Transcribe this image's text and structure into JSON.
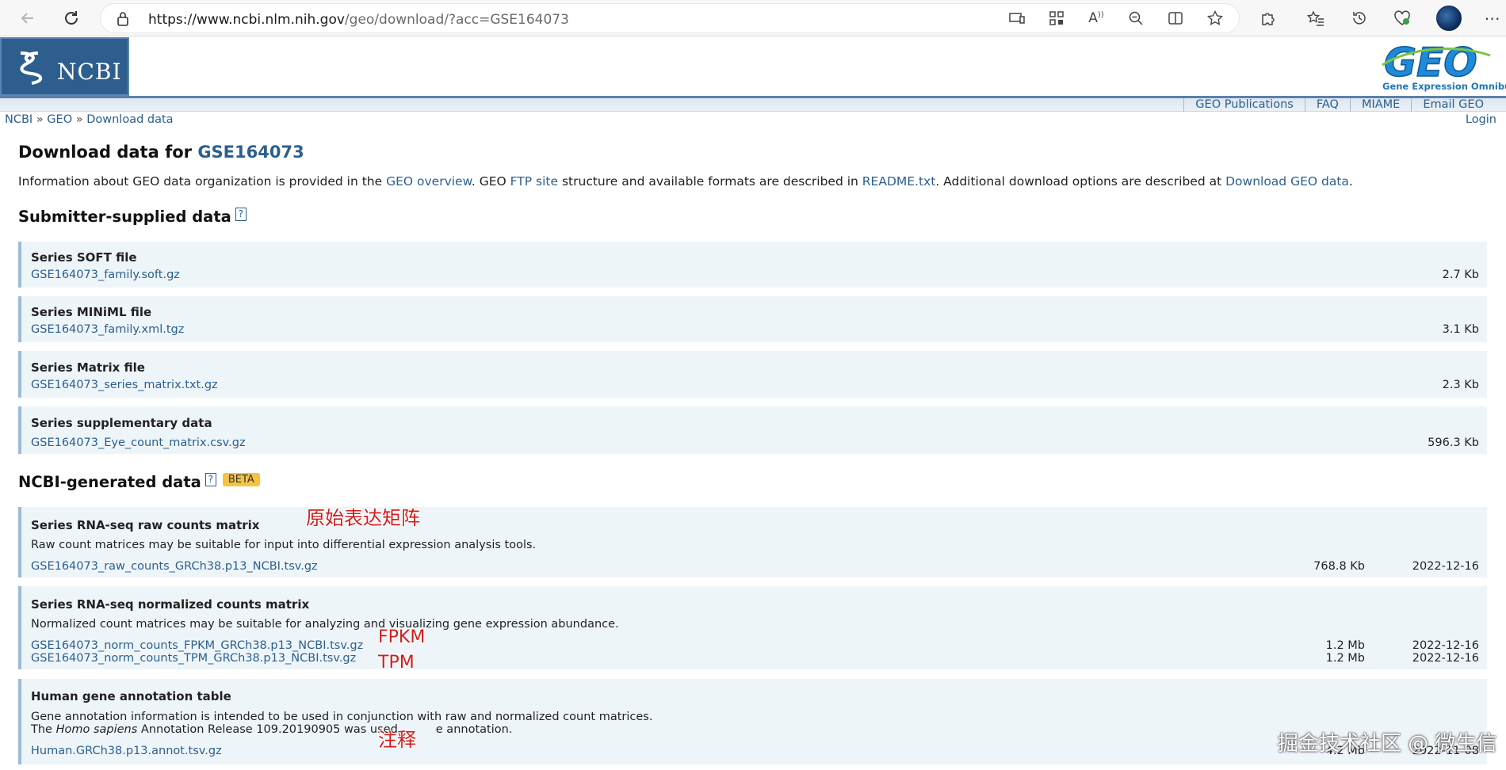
{
  "browser": {
    "url_domain": "https://www.ncbi.nlm.nih.gov",
    "url_path": "/geo/download/?acc=GSE164073"
  },
  "header": {
    "ncbi_logo_text": "NCBI",
    "geo_logo_text": "GEO",
    "geo_tagline": "Gene Expression Omnibus",
    "nav": [
      "GEO Publications",
      "FAQ",
      "MIAME",
      "Email GEO"
    ],
    "login": "Login",
    "breadcrumb": [
      "NCBI",
      "GEO",
      "Download data"
    ],
    "breadcrumb_sep": "»"
  },
  "page": {
    "title_prefix": "Download data for ",
    "accession": "GSE164073",
    "intro": {
      "t1": "Information about GEO data organization is provided in the ",
      "l1": "GEO overview",
      "t2": ". GEO ",
      "l2": "FTP site",
      "t3": " structure and available formats are described in ",
      "l3": "README.txt",
      "t4": ". Additional download options are described at ",
      "l4": "Download GEO data",
      "t5": "."
    },
    "submitter_heading": "Submitter-supplied data",
    "help_glyph": "?",
    "submitter_files": [
      {
        "title": "Series SOFT file",
        "file": "GSE164073_family.soft.gz",
        "size": "2.7 Kb"
      },
      {
        "title": "Series MINiML file",
        "file": "GSE164073_family.xml.tgz",
        "size": "3.1 Kb"
      },
      {
        "title": "Series Matrix file",
        "file": "GSE164073_series_matrix.txt.gz",
        "size": "2.3 Kb"
      },
      {
        "title": "Series supplementary data",
        "file": "GSE164073_Eye_count_matrix.csv.gz",
        "size": "596.3 Kb"
      }
    ],
    "ncbi_heading": "NCBI-generated data",
    "beta": "BETA",
    "raw": {
      "title": "Series RNA-seq raw counts matrix",
      "desc": "Raw count matrices may be suitable for input into differential expression analysis tools.",
      "file": "GSE164073_raw_counts_GRCh38.p13_NCBI.tsv.gz",
      "size": "768.8 Kb",
      "date": "2022-12-16"
    },
    "norm": {
      "title": "Series RNA-seq normalized counts matrix",
      "desc": "Normalized count matrices may be suitable for analyzing and visualizing gene expression abundance.",
      "files": [
        {
          "file": "GSE164073_norm_counts_FPKM_GRCh38.p13_NCBI.tsv.gz",
          "size": "1.2 Mb",
          "date": "2022-12-16"
        },
        {
          "file": "GSE164073_norm_counts_TPM_GRCh38.p13_NCBI.tsv.gz",
          "size": "1.2 Mb",
          "date": "2022-12-16"
        }
      ]
    },
    "annot": {
      "title": "Human gene annotation table",
      "desc1": "Gene annotation information is intended to be used in conjunction with raw and normalized count matrices.",
      "desc2_pre": "The ",
      "desc2_em": "Homo sapiens",
      "desc2_post": " Annotation Release 109.20190905 was used",
      "desc2_tail": "e annotation.",
      "file": "Human.GRCh38.p13.annot.tsv.gz",
      "size": "4.2 Mb",
      "date": "2022-11-08"
    }
  },
  "annotations": {
    "raw_note": "原始表达矩阵",
    "fpkm_note": "FPKM",
    "tpm_note": "TPM",
    "annot_note": "注释"
  },
  "watermark": "掘金技术社区 @ 微生信"
}
